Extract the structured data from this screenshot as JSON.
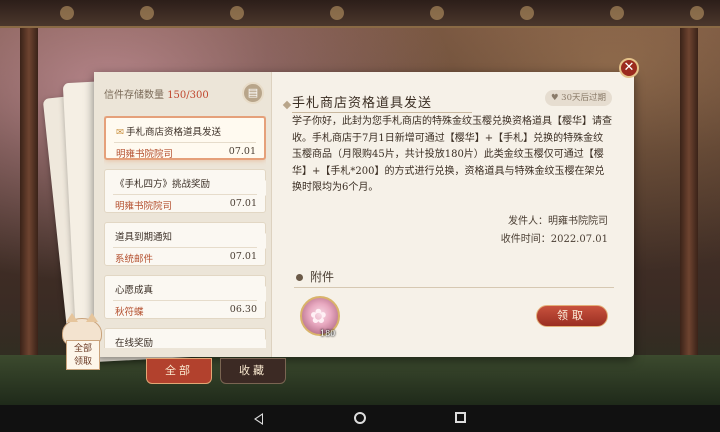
{
  "storage": {
    "label": "信件存储数量",
    "count": "150/300",
    "icon": "archive-icon"
  },
  "mails": [
    {
      "title": "手札商店资格道具发送",
      "sender": "明雍书院院司",
      "date": "07.01",
      "active": true
    },
    {
      "title": "《手札四方》挑战奖励",
      "sender": "明雍书院院司",
      "date": "07.01",
      "active": false
    },
    {
      "title": "道具到期通知",
      "sender": "系统邮件",
      "date": "07.01",
      "active": false
    },
    {
      "title": "心愿成真",
      "sender": "秋符蝶",
      "date": "06.30",
      "active": false
    },
    {
      "title": "在线奖励",
      "sender": "",
      "date": "",
      "active": false
    }
  ],
  "detail": {
    "title": "手札商店资格道具发送",
    "expire": "30天后过期",
    "body": "学子你好，此封为您手札商店的特殊金纹玉樱兑换资格道具【樱华】请查收。手札商店于7月1日新增可通过【樱华】+【手札】兑换的特殊金纹玉樱商品（月限购45片，共计投放180片）此类金纹玉樱仅可通过【樱华】+【手札*200】的方式进行兑换，资格道具与特殊金纹玉樱在架兑换时限均为6个月。",
    "sender_line": "发件人：明雍书院院司",
    "recv_line": "收件时间：2022.07.01",
    "attach_heading": "附件",
    "attachment_qty": "180",
    "claim_label": "领取"
  },
  "tabs": {
    "all": "全部",
    "fav": "收藏"
  },
  "claim_all": {
    "line1": "全部",
    "line2": "领取"
  },
  "colors": {
    "accent": "#b2412d",
    "badge": "#c0462e",
    "panel": "#f6f1e8"
  }
}
